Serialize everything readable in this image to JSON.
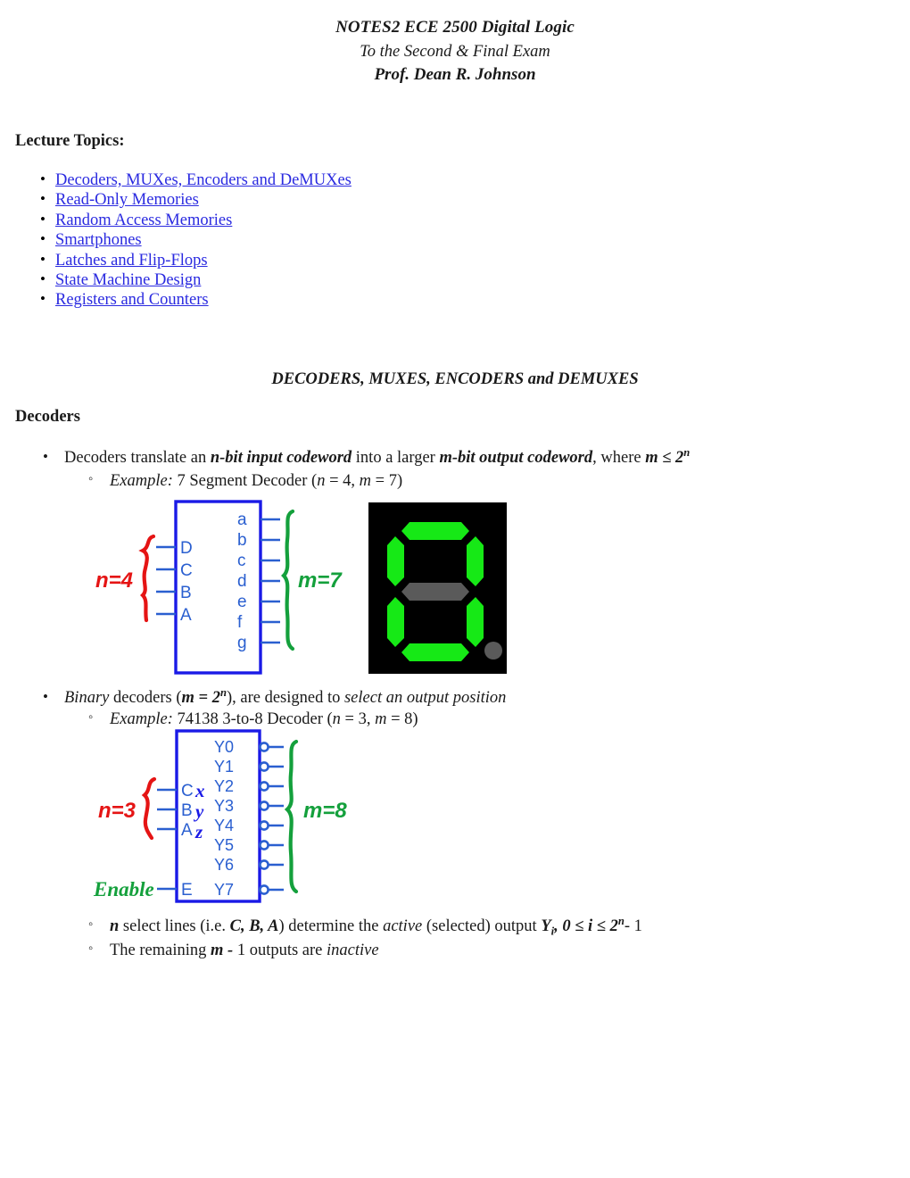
{
  "header": {
    "line1": "NOTES2 ECE 2500 Digital Logic",
    "line2": "To the Second & Final Exam",
    "line3": "Prof. Dean R. Johnson"
  },
  "lecture_topics": {
    "title": "Lecture Topics:",
    "items": [
      "Decoders, MUXes, Encoders and DeMUXes",
      "Read-Only Memories",
      "Random Access Memories",
      "Smartphones",
      "Latches and Flip-Flops",
      "State Machine Design",
      "Registers and Counters"
    ]
  },
  "section": {
    "heading": "DECODERS, MUXES, ENCODERS and DEMUXES",
    "subheading": "Decoders"
  },
  "bullets": {
    "b1_p1": "Decoders translate an ",
    "b1_bold1": "n-bit input codeword",
    "b1_p2": " into a larger ",
    "b1_bold2": "m-bit output codeword",
    "b1_p3": ", where ",
    "b1_bold3": "m ≤ 2",
    "b1_sup3": "n",
    "b1_sub_example_label": "Example:",
    "b1_sub_example_text": "7 Segment Decoder (",
    "b1_sub_example_n": "n",
    "b1_sub_example_n_val": " = 4, ",
    "b1_sub_example_m": "m",
    "b1_sub_example_m_val": " = 7)",
    "b2_italic1": "Binary",
    "b2_p1": " decoders (",
    "b2_bold1": "m = 2",
    "b2_sup1": "n",
    "b2_p2": "), are designed to ",
    "b2_italic2": "select an output position",
    "b2_sub_example_label": "Example:",
    "b2_sub_example_text": "74138 3-to-8 Decoder (",
    "b2_sub_example_n": "n",
    "b2_sub_example_n_val": " = 3, ",
    "b2_sub_example_m": "m",
    "b2_sub_example_m_val": " = 8)",
    "b3_bold_n": "n",
    "b3_p1": " select lines (i.e. ",
    "b3_bold_cba": "C, B, A",
    "b3_p2": ") determine the ",
    "b3_italic_active": "active",
    "b3_p3": " (selected) output ",
    "b3_bold_y": "Y",
    "b3_sub_i": "i",
    "b3_bold_range": ", 0 ≤ i ≤ 2",
    "b3_sup_n": "n",
    "b3_p4": "- 1",
    "b4_p1": "The remaining ",
    "b4_bold": "m - ",
    "b4_p2": "1 outputs are ",
    "b4_italic": "inactive"
  },
  "figure_seven_segment": {
    "caption_alt": "7 segment decoder block diagram",
    "inputs": [
      "D",
      "C",
      "B",
      "A"
    ],
    "outputs": [
      "a",
      "b",
      "c",
      "d",
      "e",
      "f",
      "g"
    ],
    "annotation_inputs": "n=4",
    "annotation_outputs": "m=7",
    "annotation_inputs_color": "#e51414",
    "annotation_outputs_color": "#14a03c",
    "box_color": "#1a1ae6",
    "label_color": "#2a5fd0"
  },
  "figure_seven_segment_display": {
    "caption_alt": "7 segment LED display showing digit zero",
    "background_color": "#000000",
    "segment_on_color": "#16e916",
    "segment_off_color": "#5a5a5a",
    "segments_on": [
      "a",
      "b",
      "c",
      "d",
      "e",
      "f"
    ],
    "segments_off": [
      "g"
    ],
    "decimal_point": "off",
    "digit_shown": "0"
  },
  "figure_74138": {
    "caption_alt": "74138 3-to-8 decoder block diagram",
    "inputs": [
      "C",
      "B",
      "A"
    ],
    "handwritten_inputs": [
      "x",
      "y",
      "z"
    ],
    "enable_pin": "E",
    "enable_annotation": "Enable",
    "outputs": [
      "Y0",
      "Y1",
      "Y2",
      "Y3",
      "Y4",
      "Y5",
      "Y6",
      "Y7"
    ],
    "annotation_inputs": "n=3",
    "annotation_outputs": "m=8",
    "annotation_inputs_color": "#e51414",
    "annotation_outputs_color": "#14a03c",
    "handwriting_color": "#1a1ae6",
    "box_color": "#1a1ae6",
    "label_color": "#2a5fd0",
    "outputs_active_low": true
  }
}
